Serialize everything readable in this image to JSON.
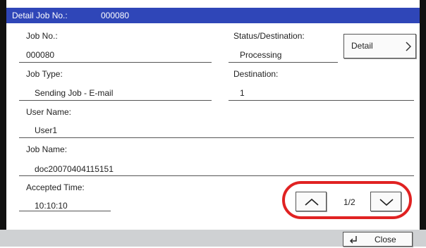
{
  "header": {
    "label": "Detail Job No.:",
    "job_no": "000080"
  },
  "fields": {
    "job_no": {
      "label": "Job No.:",
      "value": "000080"
    },
    "status": {
      "label": "Status/Destination:",
      "value": "Processing"
    },
    "job_type": {
      "label": "Job Type:",
      "value": "Sending Job - E-mail"
    },
    "destination": {
      "label": "Destination:",
      "value": "1"
    },
    "user_name": {
      "label": "User Name:",
      "value": "User1"
    },
    "job_name": {
      "label": "Job Name:",
      "value": "doc20070404115151"
    },
    "accepted_time": {
      "label": "Accepted Time:",
      "value": "10:10:10"
    }
  },
  "buttons": {
    "detail": "Detail",
    "close": "Close"
  },
  "pagination": {
    "indicator": "1/2"
  },
  "colors": {
    "title_bar": "#2f46b8",
    "highlight": "#e02222",
    "bottom_bar": "#cfd1d3"
  },
  "icons": {
    "detail": "chevron-right-icon",
    "up": "chevron-up-icon",
    "down": "chevron-down-icon",
    "close": "return-arrow-icon"
  }
}
